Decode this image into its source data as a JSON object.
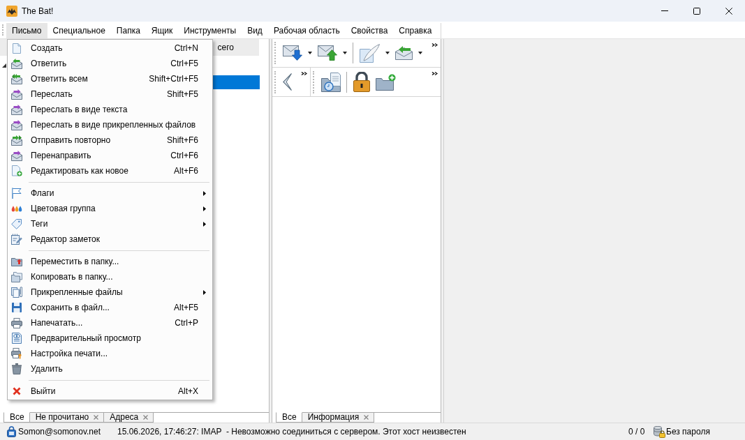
{
  "window": {
    "title": "The Bat!"
  },
  "menu_bar": [
    {
      "label": "Письмо",
      "selected": true
    },
    {
      "label": "Специальное",
      "selected": false
    },
    {
      "label": "Папка",
      "selected": false
    },
    {
      "label": "Ящик",
      "selected": false
    },
    {
      "label": "Инструменты",
      "selected": false
    },
    {
      "label": "Вид",
      "selected": false
    },
    {
      "label": "Рабочая область",
      "selected": false
    },
    {
      "label": "Свойства",
      "selected": false
    },
    {
      "label": "Справка",
      "selected": false
    }
  ],
  "dropdown_menu": {
    "sections": [
      {
        "items": [
          {
            "label": "Создать",
            "shortcut": "Ctrl+N",
            "submenu": false
          },
          {
            "label": "Ответить",
            "shortcut": "Ctrl+F5",
            "submenu": false
          },
          {
            "label": "Ответить всем",
            "shortcut": "Shift+Ctrl+F5",
            "submenu": false
          },
          {
            "label": "Переслать",
            "shortcut": "Shift+F5",
            "submenu": false
          },
          {
            "label": "Переслать в виде текста",
            "submenu": false
          },
          {
            "label": "Переслать в виде прикрепленных файлов",
            "submenu": false
          },
          {
            "label": "Отправить повторно",
            "shortcut": "Shift+F6",
            "submenu": false
          },
          {
            "label": "Перенаправить",
            "shortcut": "Ctrl+F6",
            "submenu": false
          },
          {
            "label": "Редактировать как новое",
            "shortcut": "Alt+F6",
            "submenu": false
          }
        ]
      },
      {
        "items": [
          {
            "label": "Флаги",
            "submenu": true
          },
          {
            "label": "Цветовая группа",
            "submenu": true
          },
          {
            "label": "Теги",
            "submenu": true
          },
          {
            "label": "Редактор заметок",
            "submenu": false
          }
        ]
      },
      {
        "items": [
          {
            "label": "Переместить в папку...",
            "submenu": false
          },
          {
            "label": "Копировать в папку...",
            "submenu": false
          },
          {
            "label": "Прикрепленные файлы",
            "submenu": true
          },
          {
            "label": "Сохранить в файл...",
            "shortcut": "Alt+F5",
            "submenu": false
          },
          {
            "label": "Напечатать...",
            "shortcut": "Ctrl+P",
            "submenu": false
          },
          {
            "label": "Предварительный просмотр",
            "submenu": false
          },
          {
            "label": "Настройка печати...",
            "submenu": false
          },
          {
            "label": "Удалить",
            "submenu": false
          }
        ]
      },
      {
        "items": [
          {
            "label": "Выйти",
            "shortcut": "Alt+X",
            "submenu": false
          }
        ]
      }
    ]
  },
  "folder_panel": {
    "column_header": "сего",
    "tree": [
      {
        "expanded": true,
        "selected": false,
        "children": [
          {
            "selected": true
          }
        ]
      }
    ],
    "tabs": [
      {
        "label": "Все",
        "selected": true,
        "closable": false
      },
      {
        "label": "Не прочитано",
        "selected": false,
        "closable": true
      },
      {
        "label": "Адреса",
        "selected": false,
        "closable": true
      }
    ]
  },
  "message_panel": {
    "toolbar_rows": [
      {
        "toolbars": [
          {
            "groups": [
              [
                {
                  "dropdown": true
                },
                {
                  "dropdown": true
                }
              ],
              [
                {
                  "dropdown": true
                },
                {
                  "dropdown": true
                }
              ]
            ]
          }
        ]
      },
      {
        "toolbars": [
          {
            "groups": [
              [
                {
                  "dropdown": false
                }
              ]
            ]
          },
          {
            "groups": [
              [
                {
                  "dropdown": false
                }
              ],
              [
                {
                  "dropdown": false
                },
                {
                  "dropdown": false
                }
              ]
            ]
          }
        ]
      }
    ],
    "tabs": [
      {
        "label": "Все",
        "selected": true,
        "closable": false
      },
      {
        "label": "Информация",
        "selected": false,
        "closable": true
      }
    ]
  },
  "status_bar": {
    "account": "Somon@somonov.net",
    "log_message": "15.06.2026, 17:46:27: IMAP  - Невозможно соединиться с сервером. Этот хост неизвестен",
    "counter": "0 / 0",
    "password_status": "Без пароля"
  }
}
